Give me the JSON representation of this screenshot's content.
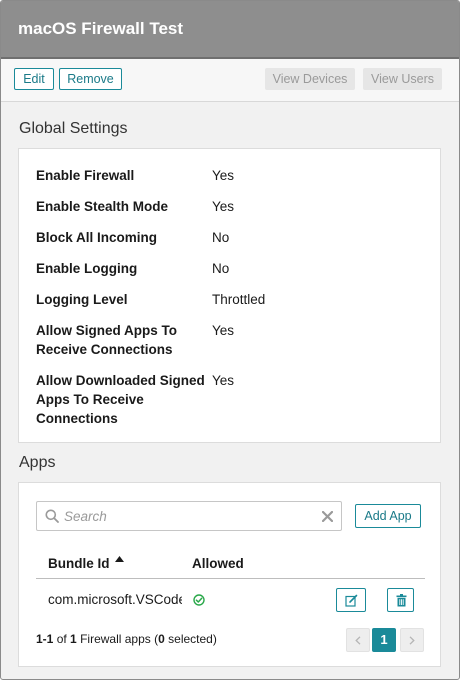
{
  "window": {
    "title": "macOS Firewall Test"
  },
  "toolbar": {
    "edit_label": "Edit",
    "remove_label": "Remove",
    "view_devices_label": "View Devices",
    "view_users_label": "View Users"
  },
  "global_settings": {
    "title": "Global Settings",
    "rows": [
      {
        "label": "Enable Firewall",
        "value": "Yes"
      },
      {
        "label": "Enable Stealth Mode",
        "value": "Yes"
      },
      {
        "label": "Block All Incoming",
        "value": "No"
      },
      {
        "label": "Enable Logging",
        "value": "No"
      },
      {
        "label": "Logging Level",
        "value": "Throttled"
      },
      {
        "label": "Allow Signed Apps To Receive Connections",
        "value": "Yes"
      },
      {
        "label": "Allow Downloaded Signed Apps To Receive Connections",
        "value": "Yes"
      }
    ]
  },
  "apps": {
    "title": "Apps",
    "search_placeholder": "Search",
    "add_app_label": "Add App",
    "columns": {
      "bundle_id": "Bundle Id",
      "allowed": "Allowed"
    },
    "sort": {
      "column": "bundle_id",
      "direction": "ascending"
    },
    "rows": [
      {
        "bundle_id": "com.microsoft.VSCode",
        "allowed": true
      }
    ],
    "footer": {
      "range": "1-1",
      "of_word": "of",
      "total": "1",
      "noun": "Firewall apps",
      "selected_count": "0",
      "selected_word": "selected"
    },
    "pager": {
      "current_page": "1"
    }
  },
  "colors": {
    "accent": "#1a8a99",
    "success": "#2aa84a",
    "titlebar": "#8e8e8e"
  }
}
